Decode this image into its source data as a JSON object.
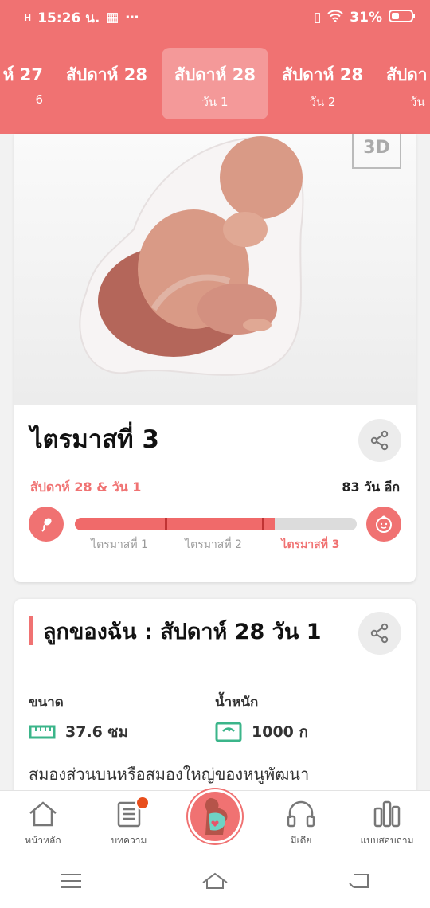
{
  "status_bar": {
    "network": "H",
    "time": "15:26 น.",
    "battery": "31%"
  },
  "week_tabs": [
    {
      "title": "ห์ 27",
      "subtitle": "6"
    },
    {
      "title": "สัปดาห์ 28",
      "subtitle": ""
    },
    {
      "title": "สัปดาห์ 28",
      "subtitle": "วัน 1"
    },
    {
      "title": "สัปดาห์ 28",
      "subtitle": "วัน 2"
    },
    {
      "title": "สัปดา",
      "subtitle": "วัน"
    }
  ],
  "viewer": {
    "badge_3d": "3D"
  },
  "trimester_card": {
    "title": "ไตรมาสที่ 3",
    "week_label": "สัปดาห์ 28 & วัน 1",
    "days_left": "83 วัน อีก",
    "progress": 0.71,
    "trimester_labels": [
      "ไตรมาสที่ 1",
      "ไตรมาสที่ 2",
      "ไตรมาสที่ 3"
    ]
  },
  "baby_card": {
    "title": "ลูกของฉัน : สัปดาห์ 28 วัน 1",
    "size_label": "ขนาด",
    "size_value": "37.6 ซม",
    "weight_label": "น้ำหนัก",
    "weight_value": "1000 ก",
    "description": "สมองส่วนบนหรือสมองใหญ่ของหนูพัฒนา"
  },
  "bottom_nav": {
    "home": "หน้าหลัก",
    "articles": "บทความ",
    "media": "มีเดีย",
    "survey": "แบบสอบถาม"
  },
  "colors": {
    "accent": "#f07272",
    "badge": "#e84e1c",
    "track": "#dcdcdc"
  }
}
